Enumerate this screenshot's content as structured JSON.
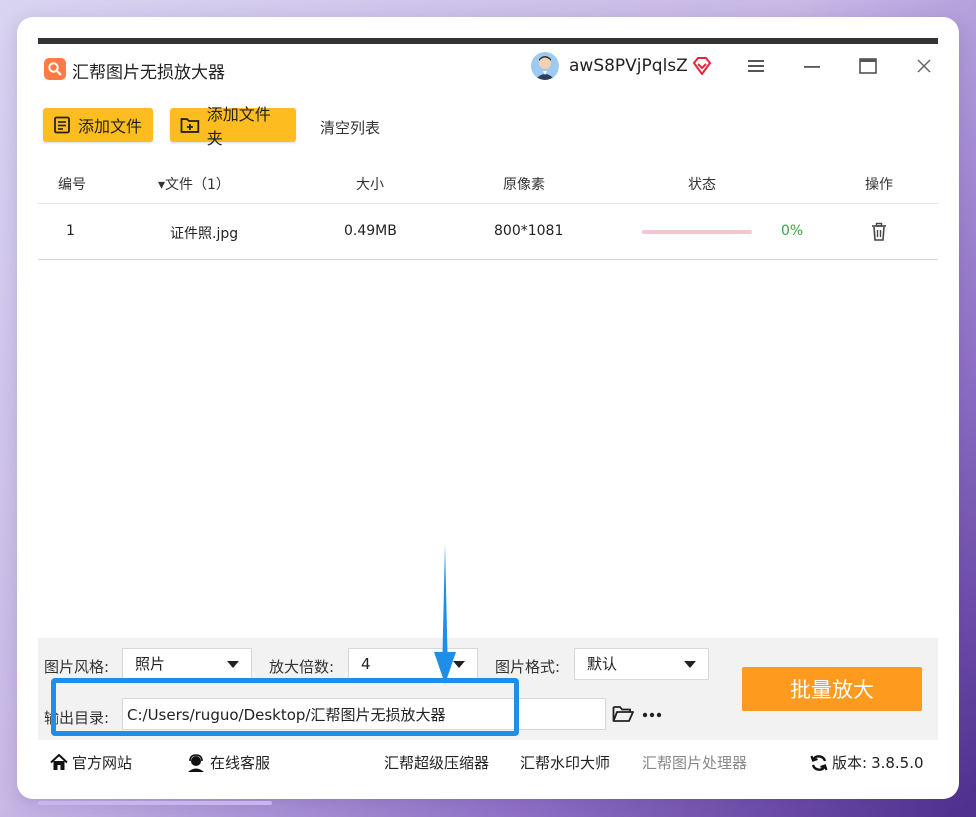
{
  "window": {
    "title": "汇帮图片无损放大器",
    "username": "awS8PVjPqlsZ"
  },
  "toolbar": {
    "add_file": "添加文件",
    "add_folder": "添加文件夹",
    "clear_list": "清空列表"
  },
  "table": {
    "columns": [
      "编号",
      "▾文件（1）",
      "大小",
      "原像素",
      "状态",
      "操作"
    ],
    "rows": [
      {
        "index": "1",
        "file": "证件照.jpg",
        "size": "0.49MB",
        "pixels": "800*1081",
        "progress": 0,
        "progress_text": "0%"
      }
    ]
  },
  "settings": {
    "style_label": "图片风格:",
    "style_value": "照片",
    "scale_label": "放大倍数:",
    "scale_value": "4",
    "format_label": "图片格式:",
    "format_value": "默认",
    "output_label": "输出目录:",
    "output_value": "C:/Users/ruguo/Desktop/汇帮图片无损放大器",
    "batch_button": "批量放大"
  },
  "footer": {
    "official_site": "官方网站",
    "online_service": "在线客服",
    "compressor": "汇帮超级压缩器",
    "watermark": "汇帮水印大师",
    "processor": "汇帮图片处理器",
    "version_label": "版本:",
    "version_value": "3.8.5.0"
  },
  "colors": {
    "primary_button": "#fdbd20",
    "batch_button": "#fe9a1e",
    "highlight": "#1e8ee8",
    "progress_text": "#3aa43a"
  }
}
